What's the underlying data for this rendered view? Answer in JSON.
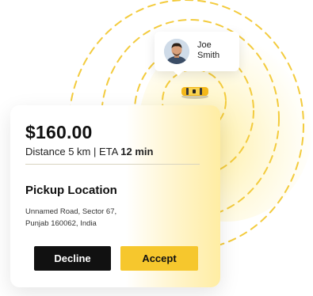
{
  "driver": {
    "first_name": "Joe",
    "last_name": "Smith"
  },
  "ride": {
    "price": "$160.00",
    "distance_label": "Distance",
    "distance": "5 km",
    "separator": "|",
    "eta_label": "ETA",
    "eta": "12 min"
  },
  "pickup": {
    "title": "Pickup Location",
    "address_line1": "Unnamed Road, Sector 67,",
    "address_line2": "Punjab 160062, India"
  },
  "actions": {
    "decline_label": "Decline",
    "accept_label": "Accept"
  },
  "colors": {
    "accent": "#f6c72d",
    "decline_bg": "#111111",
    "ring": "#f3cb3d"
  },
  "icons": {
    "avatar": "driver-avatar",
    "car": "taxi-car-icon"
  }
}
